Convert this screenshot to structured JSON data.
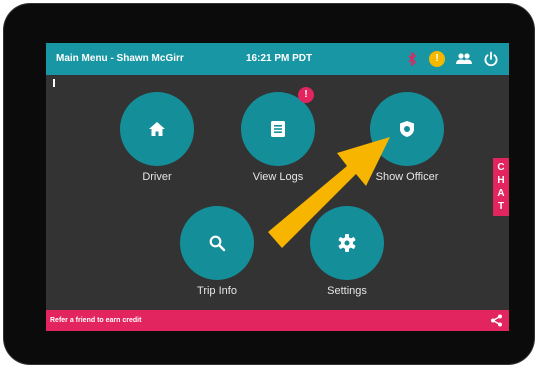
{
  "header": {
    "title": "Main Menu - Shawn McGirr",
    "time": "16:21 PM PDT",
    "alert_symbol": "!",
    "icons": [
      "bluetooth-icon",
      "alert-icon",
      "people-icon",
      "power-icon"
    ]
  },
  "menu": {
    "driver_label": "Driver",
    "view_logs_label": "View Logs",
    "view_logs_badge": "!",
    "show_officer_label": "Show Officer",
    "trip_info_label": "Trip Info",
    "settings_label": "Settings"
  },
  "chat": {
    "letters": [
      "C",
      "H",
      "A",
      "T"
    ]
  },
  "footer": {
    "text": "Refer a friend to earn credit",
    "icon": "share-icon"
  },
  "colors": {
    "teal_bar": "#1996a3",
    "teal_button": "#148e99",
    "pink": "#e2245f",
    "screen_bg": "#333333",
    "arrow": "#f7b500",
    "alert": "#f5b800"
  }
}
